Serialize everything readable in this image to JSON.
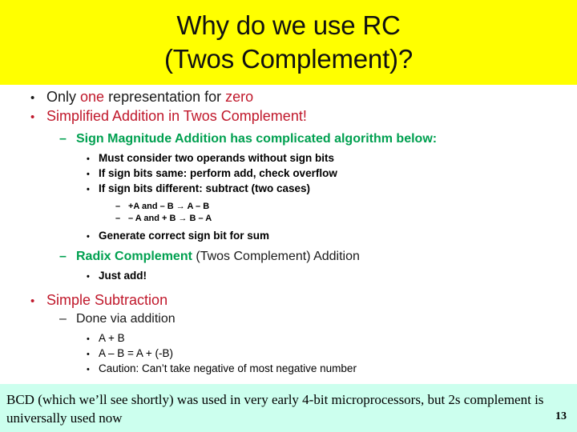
{
  "slide": {
    "title": {
      "line1": "Why do we use RC",
      "line2": "(Twos Complement)?",
      "banner_color": "#ffff00"
    },
    "colors": {
      "red": "#c0182b",
      "green": "#00a050",
      "black": "#1a1a1a",
      "banner": "#ffff00",
      "footer_bg": "#ccffee"
    },
    "markers": {
      "bullet": "•",
      "dash": "–"
    },
    "bullets": {
      "b1_pre": "Only ",
      "b1_hl1": "one",
      "b1_mid": " representation for ",
      "b1_hl2": "zero",
      "b2": "Simplified Addition in Twos Complement!",
      "b3": "Sign Magnitude Addition has complicated algorithm below:",
      "b4": "Must consider two operands without sign bits",
      "b5": "If sign bits same: perform add, check overflow",
      "b6": "If sign bits different: subtract (two cases)",
      "b7": "+A and – B → A – B",
      "b8": "– A and + B → B – A",
      "b9": "Generate correct sign bit for sum",
      "b10_hl": "Radix Complement",
      "b10_rest": " (Twos Complement) Addition",
      "b11": "Just add!",
      "b12": "Simple Subtraction",
      "b13": "Done via addition",
      "b14": "A + B",
      "b15": "A – B = A + (-B)",
      "b16": "Caution: Can’t take negative of most negative number"
    },
    "footer": {
      "note": "BCD (which we’ll see shortly) was used in very early 4-bit microprocessors, but 2s complement is universally used now",
      "page_number": "13"
    }
  }
}
